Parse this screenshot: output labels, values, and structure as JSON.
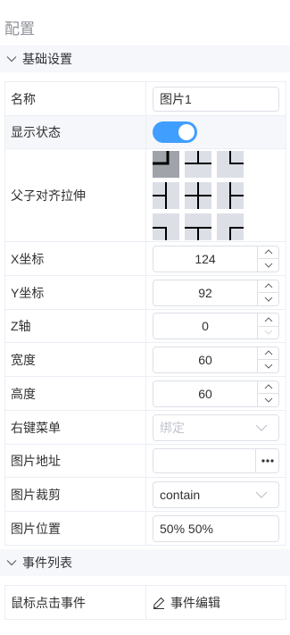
{
  "panel_title": "配置",
  "sections": {
    "basic": {
      "label": "基础设置"
    },
    "events": {
      "label": "事件列表"
    }
  },
  "fields": {
    "name": {
      "label": "名称",
      "value": "图片1"
    },
    "visible": {
      "label": "显示状态",
      "on": true
    },
    "align": {
      "label": "父子对齐拉伸",
      "selected": "top-left"
    },
    "x": {
      "label": "X坐标",
      "value": "124"
    },
    "y": {
      "label": "Y坐标",
      "value": "92"
    },
    "z": {
      "label": "Z轴",
      "value": "0"
    },
    "width": {
      "label": "宽度",
      "value": "60"
    },
    "height": {
      "label": "高度",
      "value": "60"
    },
    "context_menu": {
      "label": "右键菜单",
      "placeholder": "绑定"
    },
    "image_url": {
      "label": "图片地址",
      "value": ""
    },
    "image_fit": {
      "label": "图片裁剪",
      "value": "contain"
    },
    "image_position": {
      "label": "图片位置",
      "value": "50% 50%"
    }
  },
  "events": {
    "click": {
      "label": "鼠标点击事件",
      "action": "事件编辑"
    }
  },
  "icons": {
    "section_toggle": "chevron-down-icon",
    "select_arrow": "chevron-down-icon",
    "url_picker": "more-dots-icon",
    "edit": "edit-pen-icon"
  },
  "colors": {
    "accent": "#409eff",
    "align_active": "#a0a4aa",
    "align_idle": "#dcdfe6"
  }
}
